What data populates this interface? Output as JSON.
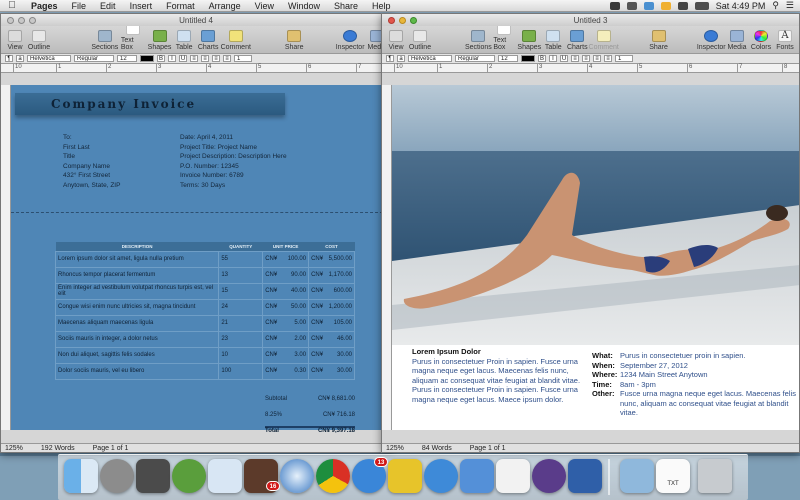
{
  "menubar": {
    "app": "Pages",
    "items": [
      "File",
      "Edit",
      "Insert",
      "Format",
      "Arrange",
      "View",
      "Window",
      "Share",
      "Help"
    ],
    "clock": "Sat 4:49 PM"
  },
  "toolbar": {
    "items": [
      "View",
      "Outline",
      "Sections",
      "Text Box",
      "Shapes",
      "Table",
      "Charts",
      "Comment",
      "Share",
      "Inspector",
      "Media",
      "Colors",
      "Fonts"
    ]
  },
  "format": {
    "font": "Helvetica",
    "style": "Regular",
    "size": "12",
    "spacing": "1"
  },
  "window_left": {
    "title": "Untitled 4",
    "status": {
      "zoom": "125%",
      "words": "192 Words",
      "page": "Page 1 of 1"
    }
  },
  "window_right": {
    "title": "Untitled 3",
    "status": {
      "zoom": "125%",
      "words": "84 Words",
      "page": "Page 1 of 1"
    }
  },
  "ruler": {
    "marks": [
      "10",
      "1",
      "2",
      "3",
      "4",
      "5",
      "6",
      "7",
      "8"
    ]
  },
  "invoice": {
    "title": "Company   Invoice",
    "to_label": "To:",
    "to_lines": [
      "First Last",
      "Title",
      "Company Name",
      "432° First Street",
      "Anytown, State, ZIP"
    ],
    "info_lines": [
      "Date: April 4, 2011",
      "Project Title: Project Name",
      "Project Description: Description Here",
      "P.O. Number: 12345",
      "Invoice Number: 6789",
      "Terms: 30 Days"
    ],
    "columns": [
      "DESCRIPTION",
      "QUANTITY",
      "UNIT PRICE",
      "COST"
    ],
    "currency": "CN¥",
    "rows": [
      {
        "desc": "Lorem ipsum dolor sit amet, ligula nulla pretium",
        "qty": "55",
        "price": "100.00",
        "cost": "5,500.00"
      },
      {
        "desc": "Rhoncus tempor placerat fermentum",
        "qty": "13",
        "price": "90.00",
        "cost": "1,170.00"
      },
      {
        "desc": "Enim integer ad vestibulum volutpat rhoncus turpis est, vel elit",
        "qty": "15",
        "price": "40.00",
        "cost": "600.00"
      },
      {
        "desc": "Congue wisi enim nunc ultricies sit, magna tincidunt",
        "qty": "24",
        "price": "50.00",
        "cost": "1,200.00"
      },
      {
        "desc": "Maecenas aliquam maecenas ligula",
        "qty": "21",
        "price": "5.00",
        "cost": "105.00"
      },
      {
        "desc": "Sociis mauris in integer, a dolor netus",
        "qty": "23",
        "price": "2.00",
        "cost": "46.00"
      },
      {
        "desc": "Non dui aliquet, sagittis felis sodales",
        "qty": "10",
        "price": "3.00",
        "cost": "30.00"
      },
      {
        "desc": "Dolor sociis mauris, vel eu libero",
        "qty": "100",
        "price": "0.30",
        "cost": "30.00"
      }
    ],
    "subtotal_label": "Subtotal",
    "subtotal": "8,681.00",
    "tax_label": "8.25%",
    "tax": "716.18",
    "total_label": "Total",
    "total": "9,397.18"
  },
  "flyer": {
    "heading": "Lorem Ipsum Dolor",
    "body": "Purus in consectetuer Proin in sapien. Fusce urna magna neque eget lacus. Maecenas felis nunc, aliquam ac consequat vitae feugiat at blandit vitae. Purus in consectetuer Proin in sapien. Fusce urna magna neque eget lacus. Maece ipsum dolor.",
    "details": [
      {
        "key": "What:",
        "value": "Purus in consectetuer proin in sapien."
      },
      {
        "key": "When:",
        "value": "September 27, 2012"
      },
      {
        "key": "Where:",
        "value": "1234 Main Street Anytown"
      },
      {
        "key": "Time:",
        "value": "8am - 3pm"
      },
      {
        "key": "Other:",
        "value": "Fusce urna magna neque eget lacus. Maecenas felis nunc, aliquam ac consequat vitae feugiat at blandit vitae."
      }
    ]
  },
  "dock": {
    "badges": {
      "calendar": "16",
      "appstore": "13"
    },
    "trash_label": "TXT"
  }
}
